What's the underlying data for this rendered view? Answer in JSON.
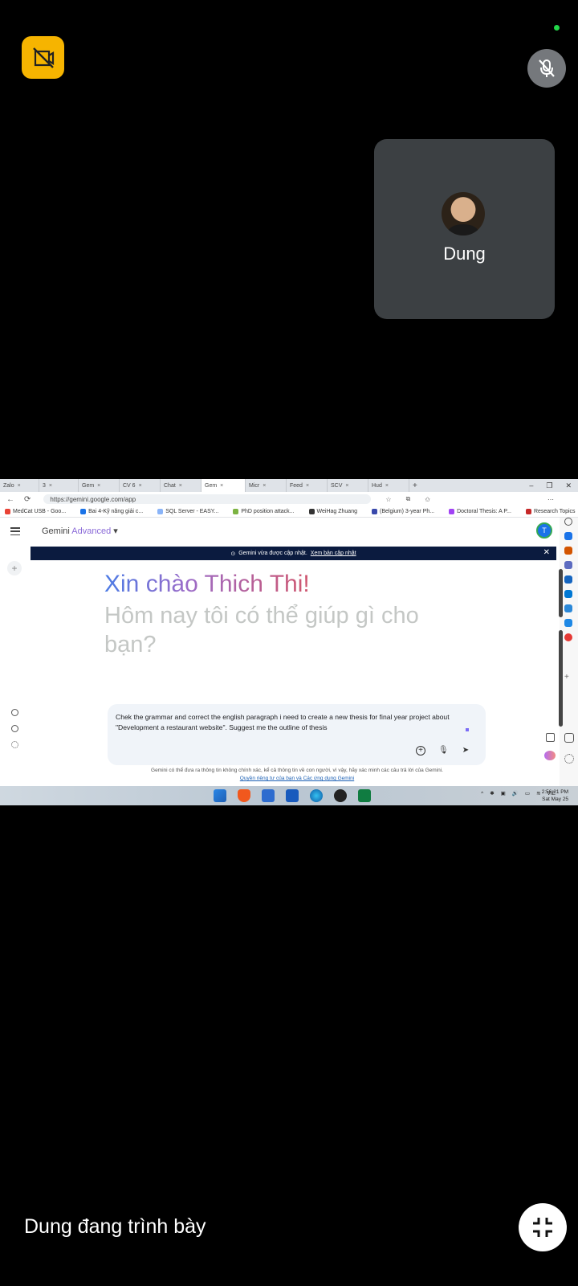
{
  "participant": {
    "name": "Dung"
  },
  "browser": {
    "tabs": [
      "Zalo",
      "3",
      "Gem",
      "CV 6",
      "Chat",
      "Gem",
      "Micr",
      "Feed",
      "SCV",
      "Hud"
    ],
    "active_tab_index": 5,
    "url": "https://gemini.google.com/app",
    "bookmarks": [
      "MedCat USB - Goo...",
      "Bai 4-Kỹ năng giải c...",
      "SQL Server - EASY...",
      "PhD position attack...",
      "WeiHag Zhuang",
      "(Belgium) 3-year Ph...",
      "Doctoral Thesis: A P...",
      "Research Topics"
    ]
  },
  "gemini": {
    "title": "Gemini",
    "title_tier": "Advanced",
    "avatar_initial": "T",
    "banner_text": "Gemini vừa được cập nhật.",
    "banner_link": "Xem bản cập nhật",
    "greeting": "Xin chào Thich Thi!",
    "subheading": "Hôm nay tôi có thể giúp gì cho bạn?",
    "prompt_text": "Chek the grammar and correct the english paragraph i need to create a new thesis for final year project about \"Development a restaurant website\". Suggest me the outline of thesis",
    "disclaimer": "Gemini có thể đưa ra thông tin không chính xác, kể cả thông tin về con người, vì vậy, hãy xác minh các câu trả lời của Gemini.",
    "disclaimer_link": "Quyền riêng tư của bạn và Các ứng dụng Gemini"
  },
  "taskbar": {
    "lang": "VIE",
    "time": "2:56:21 PM",
    "date": "Sat May 25"
  },
  "presenting_text": "Dung đang trình bày",
  "colors": {
    "camera_off": "#f6b400",
    "tile": "#3c4043",
    "green_dot": "#22d649"
  }
}
